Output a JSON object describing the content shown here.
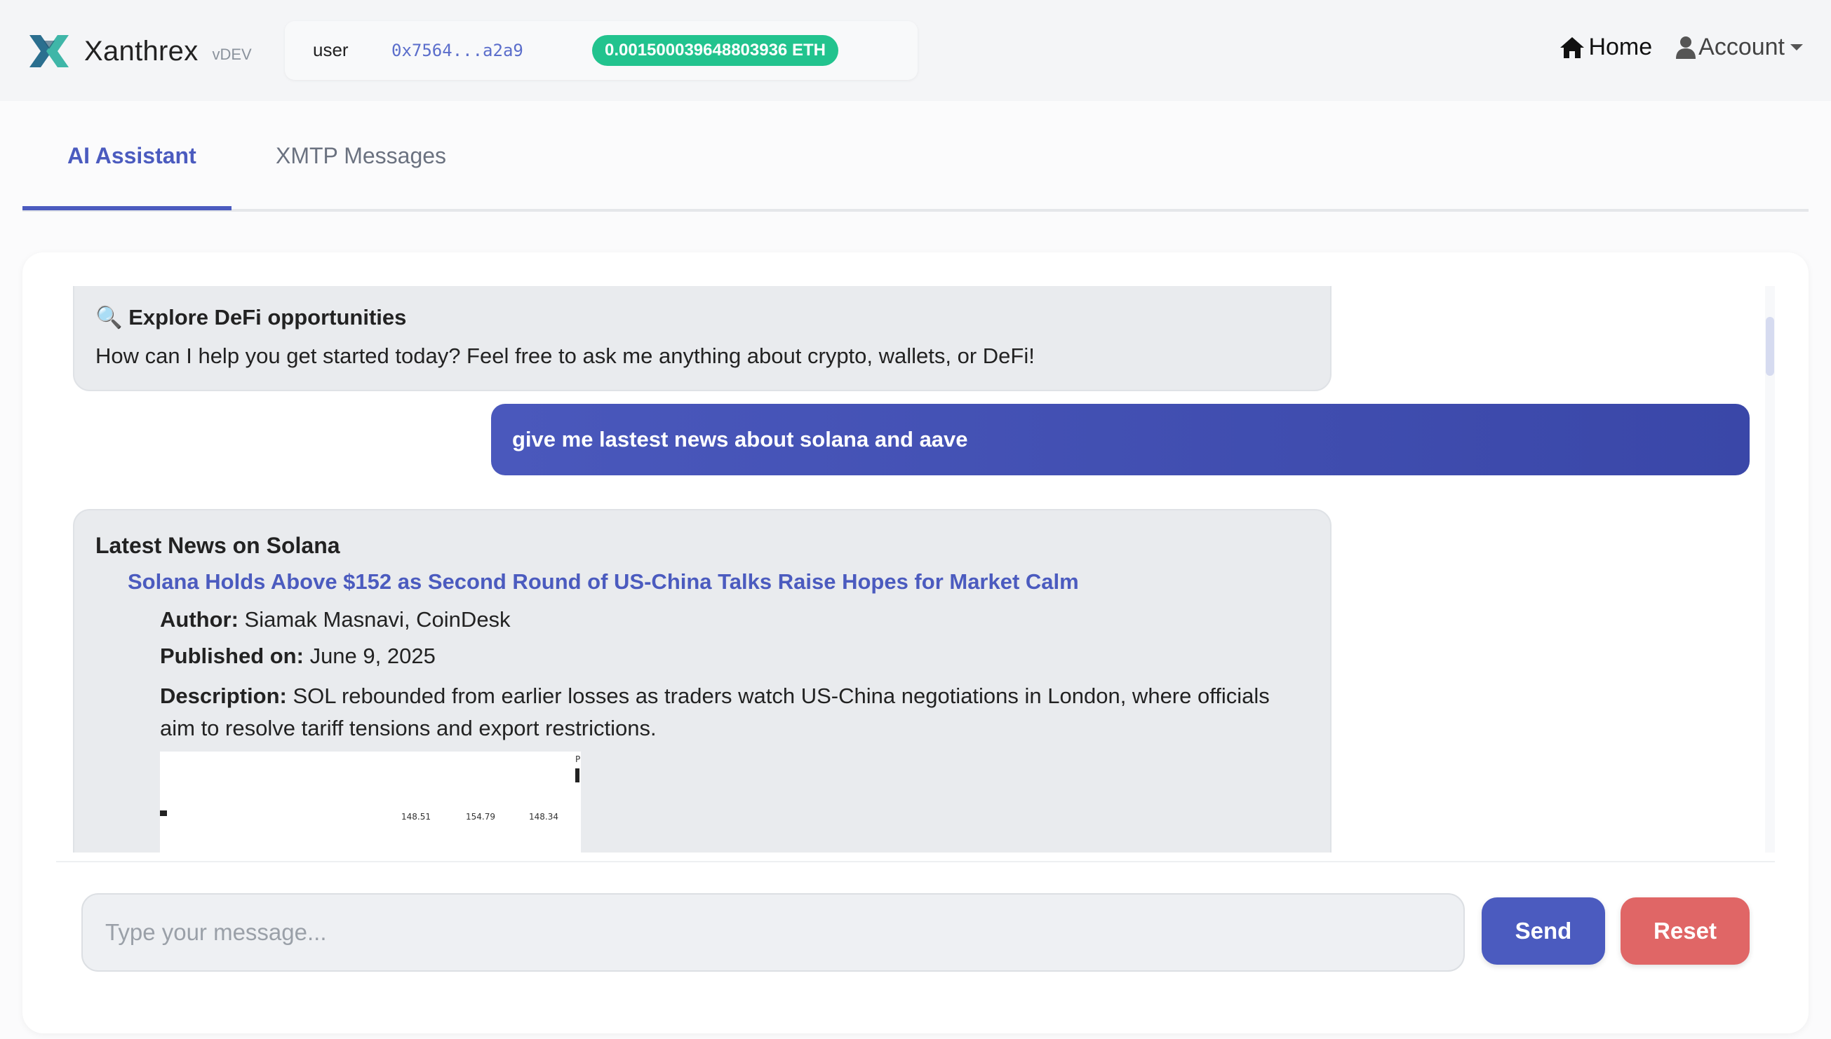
{
  "colors": {
    "accent": "#4b5bbf",
    "balance_badge": "#22c38e",
    "reset_button": "#e06666",
    "user_bubble": "#3f4cb0"
  },
  "navbar": {
    "brand_name": "Xanthrex",
    "brand_version": "vDEV",
    "logo_icon": "x-logo-icon",
    "wallet": {
      "user_label": "user",
      "address": "0x7564...a2a9",
      "balance": "0.001500039648803936 ETH"
    },
    "home_label": "Home",
    "account_label": "Account"
  },
  "tabs": [
    {
      "label": "AI Assistant",
      "active": true
    },
    {
      "label": "XMTP Messages",
      "active": false
    }
  ],
  "chat": {
    "messages": [
      {
        "role": "assistant",
        "title_icon": "magnifier-icon",
        "title": "Explore DeFi opportunities",
        "text": "How can I help you get started today? Feel free to ask me anything about crypto, wallets, or DeFi!"
      },
      {
        "role": "user",
        "text": "give me lastest news about solana and aave"
      },
      {
        "role": "assistant",
        "heading": "Latest News on Solana",
        "article": {
          "title": "Solana Holds Above $152 as Second Round of US-China Talks Raise Hopes for Market Calm",
          "author_label": "Author:",
          "author": "Siamak Masnavi, CoinDesk",
          "published_label": "Published on:",
          "published": "June 9, 2025",
          "description_label": "Description:",
          "description": "SOL rebounded from earlier losses as traders watch US-China negotiations in London, where officials aim to resolve tariff tensions and export restrictions.",
          "image_ticks": [
            "148.51",
            "154.79",
            "148.34"
          ],
          "image_corner_label": "P"
        }
      }
    ],
    "input_placeholder": "Type your message...",
    "input_value": "",
    "send_label": "Send",
    "reset_label": "Reset"
  }
}
